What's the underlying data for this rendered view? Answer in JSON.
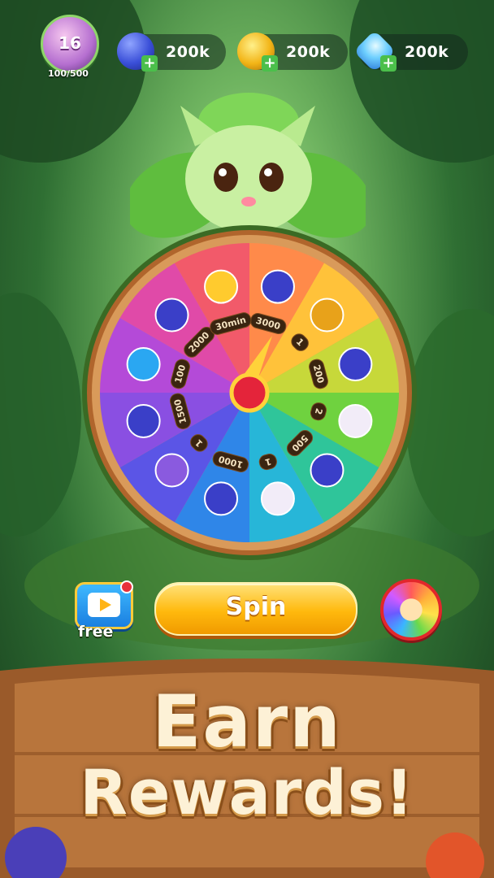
{
  "hud": {
    "level": "16",
    "level_progress": "100/500",
    "resources": [
      {
        "name": "blueberry",
        "value": "200k"
      },
      {
        "name": "coin",
        "value": "200k"
      },
      {
        "name": "gem",
        "value": "200k"
      }
    ]
  },
  "wheel": {
    "segments": [
      {
        "label": "3000",
        "prize": "blueberry",
        "color": "#ff8a4a"
      },
      {
        "label": "1",
        "prize": "treasure-chest",
        "color": "#ffc23a"
      },
      {
        "label": "200",
        "prize": "blueberry",
        "color": "#c7d83a"
      },
      {
        "label": "2",
        "prize": "shell",
        "color": "#6fd23f"
      },
      {
        "label": "500",
        "prize": "blueberry",
        "color": "#2fc59a"
      },
      {
        "label": "1",
        "prize": "shell",
        "color": "#27b6d8"
      },
      {
        "label": "1000",
        "prize": "blueberry",
        "color": "#2f86e8"
      },
      {
        "label": "1",
        "prize": "card",
        "color": "#5b55e6"
      },
      {
        "label": "1500",
        "prize": "blueberry",
        "color": "#8a4fe2"
      },
      {
        "label": "100",
        "prize": "gem",
        "color": "#b44ad8"
      },
      {
        "label": "2000",
        "prize": "blueberry",
        "color": "#e04aa8"
      },
      {
        "label": "30min",
        "prize": "potion",
        "color": "#f25a6a"
      }
    ]
  },
  "controls": {
    "free_label": "free",
    "spin_label": "Spin"
  },
  "banner": {
    "line1": "Earn",
    "line2": "Rewards!"
  }
}
